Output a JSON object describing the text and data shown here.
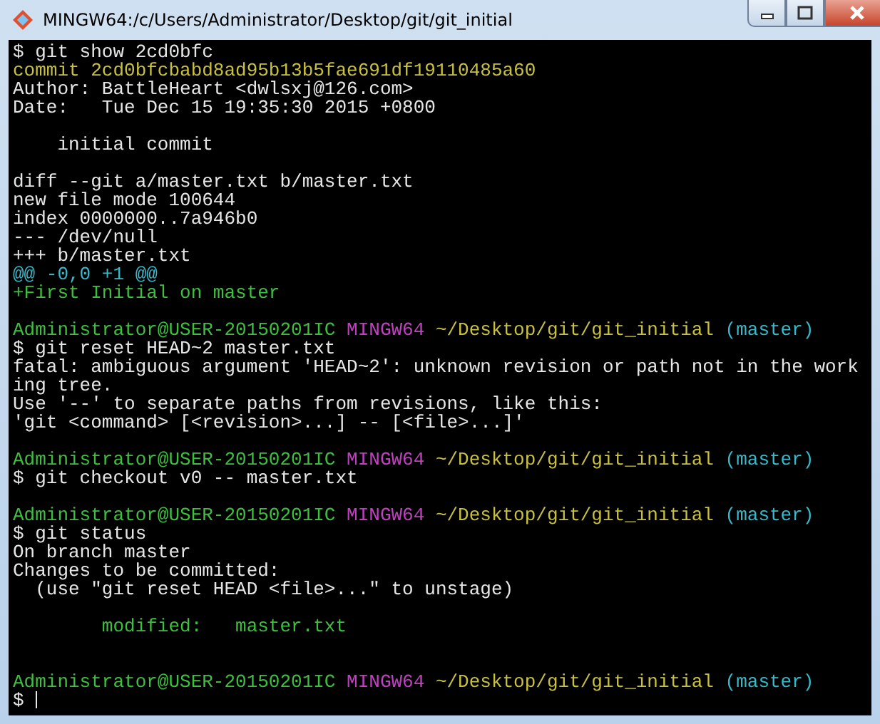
{
  "window": {
    "title": "MINGW64:/c/Users/Administrator/Desktop/git/git_initial"
  },
  "terminal": {
    "lines": [
      {
        "kind": "text",
        "segments": [
          {
            "kind": "normal",
            "text": "$ git show 2cd0bfc"
          }
        ]
      },
      {
        "kind": "text",
        "segments": [
          {
            "kind": "commit",
            "text": "commit 2cd0bfcbabd8ad95b13b5fae691df19110485a60"
          }
        ]
      },
      {
        "kind": "text",
        "segments": [
          {
            "kind": "normal",
            "text": "Author: BattleHeart <dwlsxj@126.com>"
          }
        ]
      },
      {
        "kind": "text",
        "segments": [
          {
            "kind": "normal",
            "text": "Date:   Tue Dec 15 19:35:30 2015 +0800"
          }
        ]
      },
      {
        "kind": "blank"
      },
      {
        "kind": "text",
        "segments": [
          {
            "kind": "normal",
            "text": "    initial commit"
          }
        ]
      },
      {
        "kind": "blank"
      },
      {
        "kind": "text",
        "segments": [
          {
            "kind": "normal",
            "text": "diff --git a/master.txt b/master.txt"
          }
        ]
      },
      {
        "kind": "text",
        "segments": [
          {
            "kind": "normal",
            "text": "new file mode 100644"
          }
        ]
      },
      {
        "kind": "text",
        "segments": [
          {
            "kind": "normal",
            "text": "index 0000000..7a946b0"
          }
        ]
      },
      {
        "kind": "text",
        "segments": [
          {
            "kind": "normal",
            "text": "--- /dev/null"
          }
        ]
      },
      {
        "kind": "text",
        "segments": [
          {
            "kind": "normal",
            "text": "+++ b/master.txt"
          }
        ]
      },
      {
        "kind": "text",
        "segments": [
          {
            "kind": "hunk",
            "text": "@@ -0,0 +1 @@"
          }
        ]
      },
      {
        "kind": "text",
        "segments": [
          {
            "kind": "added",
            "text": "+First Initial on master"
          }
        ]
      },
      {
        "kind": "blank"
      },
      {
        "kind": "text",
        "segments": [
          {
            "kind": "user",
            "text": "Administrator@USER-20150201IC"
          },
          {
            "kind": "host",
            "text": "MINGW64"
          },
          {
            "kind": "path",
            "text": "~/Desktop/git/git_initial"
          },
          {
            "kind": "branch",
            "text": "(master)"
          }
        ]
      },
      {
        "kind": "text",
        "segments": [
          {
            "kind": "normal",
            "text": "$ git reset HEAD~2 master.txt"
          }
        ]
      },
      {
        "kind": "text",
        "segments": [
          {
            "kind": "normal",
            "text": "fatal: ambiguous argument 'HEAD~2': unknown revision or path not in the work"
          }
        ]
      },
      {
        "kind": "text",
        "segments": [
          {
            "kind": "normal",
            "text": "ing tree."
          }
        ]
      },
      {
        "kind": "text",
        "segments": [
          {
            "kind": "normal",
            "text": "Use '--' to separate paths from revisions, like this:"
          }
        ]
      },
      {
        "kind": "text",
        "segments": [
          {
            "kind": "normal",
            "text": "'git <command> [<revision>...] -- [<file>...]'"
          }
        ]
      },
      {
        "kind": "blank"
      },
      {
        "kind": "text",
        "segments": [
          {
            "kind": "user",
            "text": "Administrator@USER-20150201IC"
          },
          {
            "kind": "host",
            "text": "MINGW64"
          },
          {
            "kind": "path",
            "text": "~/Desktop/git/git_initial"
          },
          {
            "kind": "branch",
            "text": "(master)"
          }
        ]
      },
      {
        "kind": "text",
        "segments": [
          {
            "kind": "normal",
            "text": "$ git checkout v0 -- master.txt"
          }
        ]
      },
      {
        "kind": "blank"
      },
      {
        "kind": "text",
        "segments": [
          {
            "kind": "user",
            "text": "Administrator@USER-20150201IC"
          },
          {
            "kind": "host",
            "text": "MINGW64"
          },
          {
            "kind": "path",
            "text": "~/Desktop/git/git_initial"
          },
          {
            "kind": "branch",
            "text": "(master)"
          }
        ]
      },
      {
        "kind": "text",
        "segments": [
          {
            "kind": "normal",
            "text": "$ git status"
          }
        ]
      },
      {
        "kind": "text",
        "segments": [
          {
            "kind": "normal",
            "text": "On branch master"
          }
        ]
      },
      {
        "kind": "text",
        "segments": [
          {
            "kind": "normal",
            "text": "Changes to be committed:"
          }
        ]
      },
      {
        "kind": "text",
        "segments": [
          {
            "kind": "normal",
            "text": "  (use \"git reset HEAD <file>...\" to unstage)"
          }
        ]
      },
      {
        "kind": "blank"
      },
      {
        "kind": "text",
        "segments": [
          {
            "kind": "added",
            "text": "        modified:   master.txt"
          }
        ]
      },
      {
        "kind": "blank"
      },
      {
        "kind": "blank"
      },
      {
        "kind": "text",
        "segments": [
          {
            "kind": "user",
            "text": "Administrator@USER-20150201IC"
          },
          {
            "kind": "host",
            "text": "MINGW64"
          },
          {
            "kind": "path",
            "text": "~/Desktop/git/git_initial"
          },
          {
            "kind": "branch",
            "text": "(master)"
          }
        ]
      },
      {
        "kind": "input",
        "segments": [
          {
            "kind": "normal",
            "text": "$"
          }
        ],
        "cursor": true
      }
    ]
  }
}
